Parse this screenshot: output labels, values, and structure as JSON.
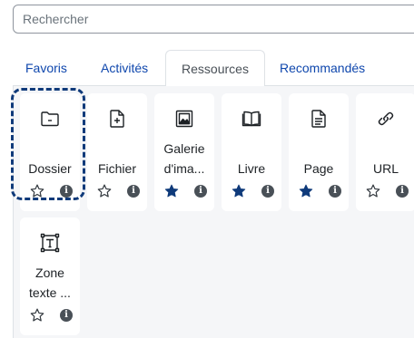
{
  "search": {
    "placeholder": "Rechercher"
  },
  "tabs": [
    {
      "label": "Favoris",
      "active": false
    },
    {
      "label": "Activités",
      "active": false
    },
    {
      "label": "Ressources",
      "active": true
    },
    {
      "label": "Recommandés",
      "active": false
    }
  ],
  "cards": [
    {
      "line1": "",
      "line2": "Dossier",
      "icon": "folder-icon",
      "starred": false
    },
    {
      "line1": "",
      "line2": "Fichier",
      "icon": "file-icon",
      "starred": false
    },
    {
      "line1": "Galerie",
      "line2": "d'ima...",
      "icon": "image-gallery-icon",
      "starred": true
    },
    {
      "line1": "",
      "line2": "Livre",
      "icon": "book-icon",
      "starred": true
    },
    {
      "line1": "",
      "line2": "Page",
      "icon": "page-icon",
      "starred": true
    },
    {
      "line1": "",
      "line2": "URL",
      "icon": "link-icon",
      "starred": false
    },
    {
      "line1": "Zone",
      "line2": "texte ...",
      "icon": "text-area-icon",
      "starred": false
    }
  ],
  "colors": {
    "accent": "#0f47ad",
    "star_filled": "#0f3a7a",
    "focus": "#0f3a7a"
  }
}
